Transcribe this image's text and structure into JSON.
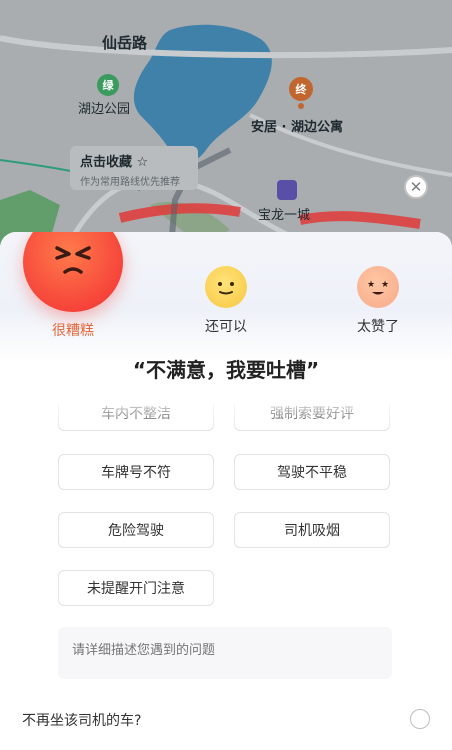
{
  "map": {
    "labels": {
      "road": "仙岳路",
      "park": "湖边公园",
      "destination": "安居 · 湖边公寓",
      "community": "宝龙一城"
    },
    "pins": {
      "park": "绿",
      "end": "终"
    },
    "favorite": {
      "title": "点击收藏",
      "subtitle": "作为常用路线优先推荐"
    }
  },
  "rating": {
    "options": [
      "很糟糕",
      "还可以",
      "太赞了"
    ],
    "selected": "很糟糕",
    "headline": "“不满意，我要吐槽”"
  },
  "tags": [
    "车内不整洁",
    "强制索要好评",
    "车牌号不符",
    "驾驶不平稳",
    "危险驾驶",
    "司机吸烟",
    "未提醒开门注意"
  ],
  "description": {
    "placeholder": "请详细描述您遇到的问题"
  },
  "no_ride": {
    "label": "不再坐该司机的车?"
  },
  "colors": {
    "accent": "#e36a3e",
    "bad_face": "#f6443a",
    "ok_face": "#f8c741",
    "great_face": "#f7a98a"
  }
}
